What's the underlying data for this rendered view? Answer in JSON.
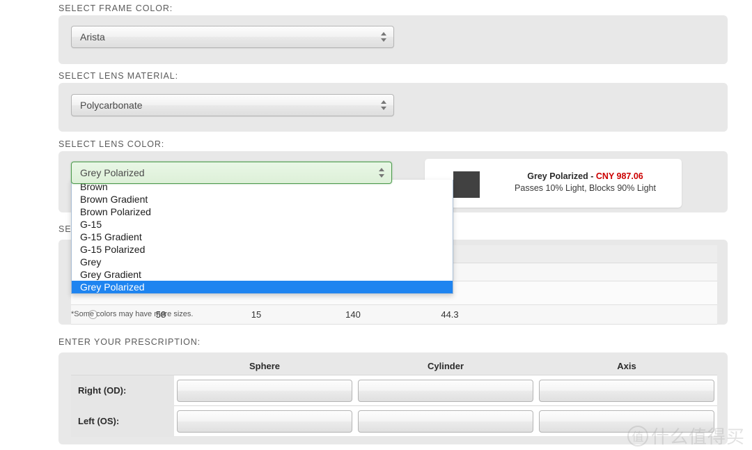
{
  "sections": {
    "frame_color": {
      "label": "SELECT FRAME COLOR:",
      "selected": "Arista"
    },
    "lens_material": {
      "label": "SELECT LENS MATERIAL:",
      "selected": "Polycarbonate"
    },
    "lens_color": {
      "label": "SELECT LENS COLOR:",
      "selected": "Grey Polarized",
      "options": [
        "Brown",
        "Brown Gradient",
        "Brown Polarized",
        "G-15",
        "G-15 Gradient",
        "G-15 Polarized",
        "Grey",
        "Grey Gradient",
        "Grey Polarized"
      ],
      "highlighted_option": "Grey Polarized",
      "info": {
        "name_price": "Grey Polarized - ",
        "price": "CNY 987.06",
        "description": "Passes 10% Light, Blocks 90% Light",
        "swatch_color": "#414141"
      }
    },
    "size": {
      "label": "SE",
      "measurements": {
        "lens_width": "58",
        "bridge": "15",
        "temple": "140",
        "lens_height": "44.3"
      },
      "footnote": "*Some colors may have more sizes."
    },
    "prescription": {
      "label": "ENTER YOUR PRESCRIPTION:",
      "columns": [
        "Sphere",
        "Cylinder",
        "Axis"
      ],
      "rows": [
        {
          "label": "Right (OD):",
          "sphere": "",
          "cylinder": "",
          "axis": ""
        },
        {
          "label": "Left (OS):",
          "sphere": "",
          "cylinder": "",
          "axis": ""
        }
      ]
    }
  },
  "watermark": {
    "mark": "值",
    "text": "什么值得买"
  },
  "colors": {
    "panel_bg": "#e8e8e8",
    "focus_green": "#4c9a4c",
    "dropdown_highlight": "#1e84f0",
    "price_red": "#cc0000"
  }
}
